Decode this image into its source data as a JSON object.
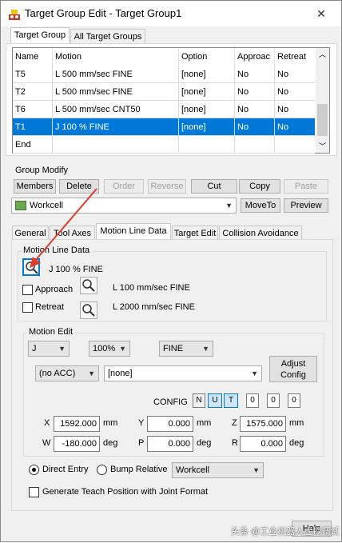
{
  "window": {
    "title": "Target Group Edit - Target Group1",
    "close_glyph": "✕"
  },
  "top_tabs": [
    "Target Group",
    "All Target Groups"
  ],
  "grid": {
    "columns": [
      "Name",
      "Motion",
      "Option",
      "Approac",
      "Retreat"
    ],
    "rows": [
      {
        "name": "T5",
        "motion": "L 500 mm/sec FINE",
        "option": "[none]",
        "approach": "No",
        "retreat": "No"
      },
      {
        "name": "T2",
        "motion": "L 500 mm/sec FINE",
        "option": "[none]",
        "approach": "No",
        "retreat": "No"
      },
      {
        "name": "T6",
        "motion": "L 500 mm/sec CNT50",
        "option": "[none]",
        "approach": "No",
        "retreat": "No"
      },
      {
        "name": "T1",
        "motion": "J 100 % FINE",
        "option": "[none]",
        "approach": "No",
        "retreat": "No",
        "selected": true
      },
      {
        "name": "End",
        "motion": "",
        "option": "",
        "approach": "",
        "retreat": ""
      }
    ]
  },
  "group_modify": {
    "label": "Group Modify",
    "buttons": [
      "Members",
      "Delete",
      "Order",
      "Reverse",
      "Cut",
      "Copy",
      "Paste"
    ],
    "frame_select": "Workcell",
    "moveto": "MoveTo",
    "preview": "Preview"
  },
  "sub_tabs": [
    "General",
    "Tool Axes",
    "Motion Line Data",
    "Target Edit",
    "Collision Avoidance"
  ],
  "motion_line_data": {
    "group_label": "Motion Line Data",
    "current": "J 100 % FINE",
    "approach": {
      "label": "Approach",
      "value": "L 100 mm/sec FINE"
    },
    "retreat": {
      "label": "Retreat",
      "value": "L 2000 mm/sec FINE"
    }
  },
  "motion_edit": {
    "label": "Motion Edit",
    "type": "J",
    "speed": "100%",
    "term": "FINE",
    "acc": "(no ACC)",
    "option": "[none]",
    "adjust_config": [
      "Adjust",
      "Config"
    ],
    "config_label": "CONFIG",
    "config_flags": [
      "N",
      "U",
      "T"
    ],
    "config_turns": [
      "0",
      "0",
      "0"
    ],
    "position": {
      "x": "1592.000",
      "y": "0.000",
      "z": "1575.000",
      "w": "-180.000",
      "p": "0.000",
      "r": "0.000",
      "unit_mm": "mm",
      "unit_deg": "deg"
    }
  },
  "entry": {
    "direct": "Direct Entry",
    "bump": "Bump Relative",
    "bump_frame": "Workcell",
    "joint_format": "Generate Teach Position with Joint Format"
  },
  "help": "Help",
  "watermark": "头条 @工业机器人虚拟调试",
  "colors": {
    "selection": "#0078d7",
    "arrow": "#e03b2f"
  },
  "icons": [
    "app-icon",
    "magnifier-icon",
    "dropdown-arrow-icon"
  ]
}
